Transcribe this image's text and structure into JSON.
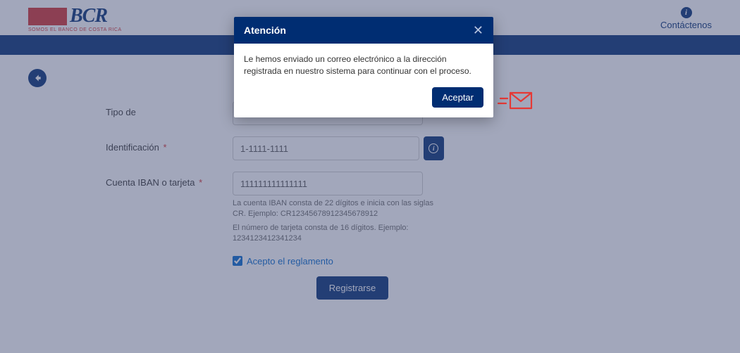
{
  "logo": {
    "brand": "BCR",
    "subtitle": "SOMOS EL   BANCO DE COSTA RICA"
  },
  "contact": {
    "label": "Contáctenos"
  },
  "form": {
    "tipo_label": "Tipo de",
    "ident_label": "Identificación",
    "ident_value": "1-1111-1111",
    "iban_label": "Cuenta IBAN o tarjeta",
    "iban_value": "111111111111111",
    "hint_iban": "La cuenta IBAN consta de 22 dígitos e inicia con las siglas CR. Ejemplo: CR12345678912345678912",
    "hint_card": "El número de tarjeta consta de 16 dígitos. Ejemplo: 1234123412341234",
    "accept_label": "Acepto el reglamento",
    "submit_label": "Registrarse"
  },
  "modal": {
    "title": "Atención",
    "body": "Le hemos enviado un correo electrónico a la dirección registrada en nuestro sistema para continuar con el proceso.",
    "accept": "Aceptar"
  }
}
